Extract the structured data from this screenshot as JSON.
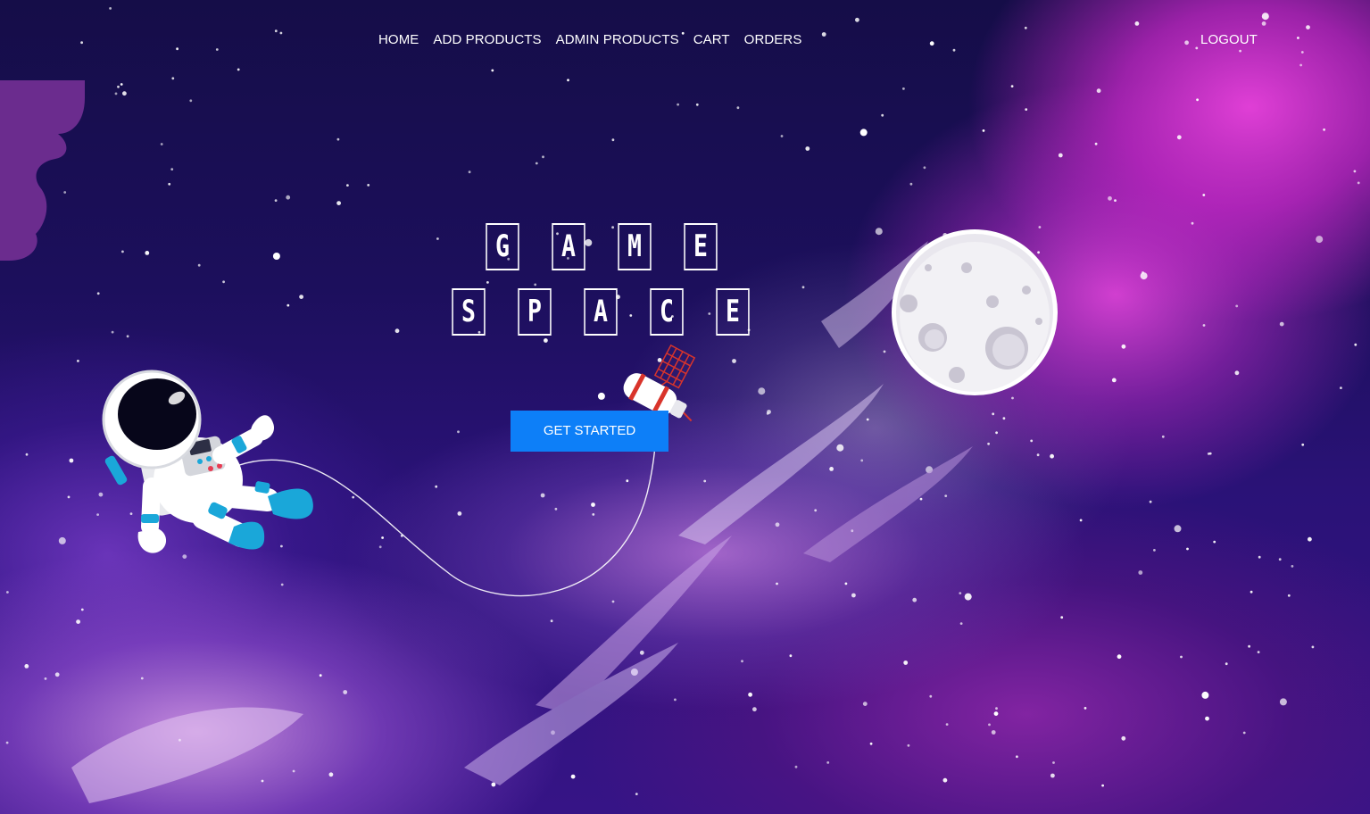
{
  "nav": {
    "links": [
      {
        "label": "HOME"
      },
      {
        "label": "ADD PRODUCTS"
      },
      {
        "label": "ADMIN PRODUCTS"
      },
      {
        "label": "CART"
      },
      {
        "label": "ORDERS"
      }
    ],
    "logout_label": "LOGOUT"
  },
  "hero": {
    "title_line1": [
      "G",
      "A",
      "M",
      "E"
    ],
    "title_line2": [
      "S",
      "P",
      "A",
      "C",
      "E"
    ],
    "cta_label": "GET STARTED"
  },
  "colors": {
    "cta_background": "#0d7ff8",
    "text": "#ffffff",
    "space_dark": "#150d48",
    "nebula_pink": "#e03fd6"
  },
  "illustrations": {
    "astronaut": "astronaut-illustration",
    "moon": "moon-illustration",
    "satellite": "satellite-illustration",
    "stars": "star-field"
  }
}
